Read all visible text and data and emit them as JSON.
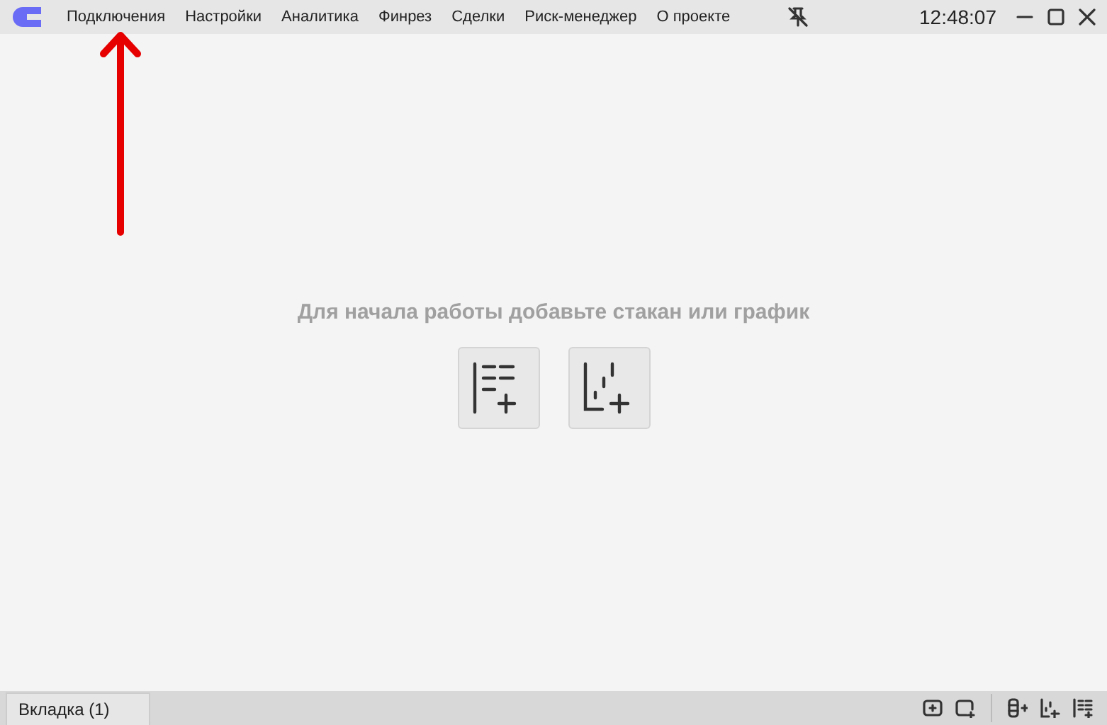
{
  "menu": [
    {
      "label": "Подключения"
    },
    {
      "label": "Настройки"
    },
    {
      "label": "Аналитика"
    },
    {
      "label": "Финрез"
    },
    {
      "label": "Сделки"
    },
    {
      "label": "Риск-менеджер"
    },
    {
      "label": "О проекте"
    }
  ],
  "clock": "12:48:07",
  "empty_message": "Для начала работы добавьте стакан или график",
  "actions": [
    {
      "kind": "orderbook"
    },
    {
      "kind": "chart"
    }
  ],
  "tabs": [
    {
      "label": "Вкладка (1)",
      "selected": true
    }
  ],
  "status_tools": [
    {
      "kind": "add-window"
    },
    {
      "kind": "add-group"
    },
    {
      "kind": "add-orderbook"
    },
    {
      "kind": "add-chart"
    },
    {
      "kind": "add-list"
    }
  ],
  "annotation": {
    "kind": "arrow"
  }
}
